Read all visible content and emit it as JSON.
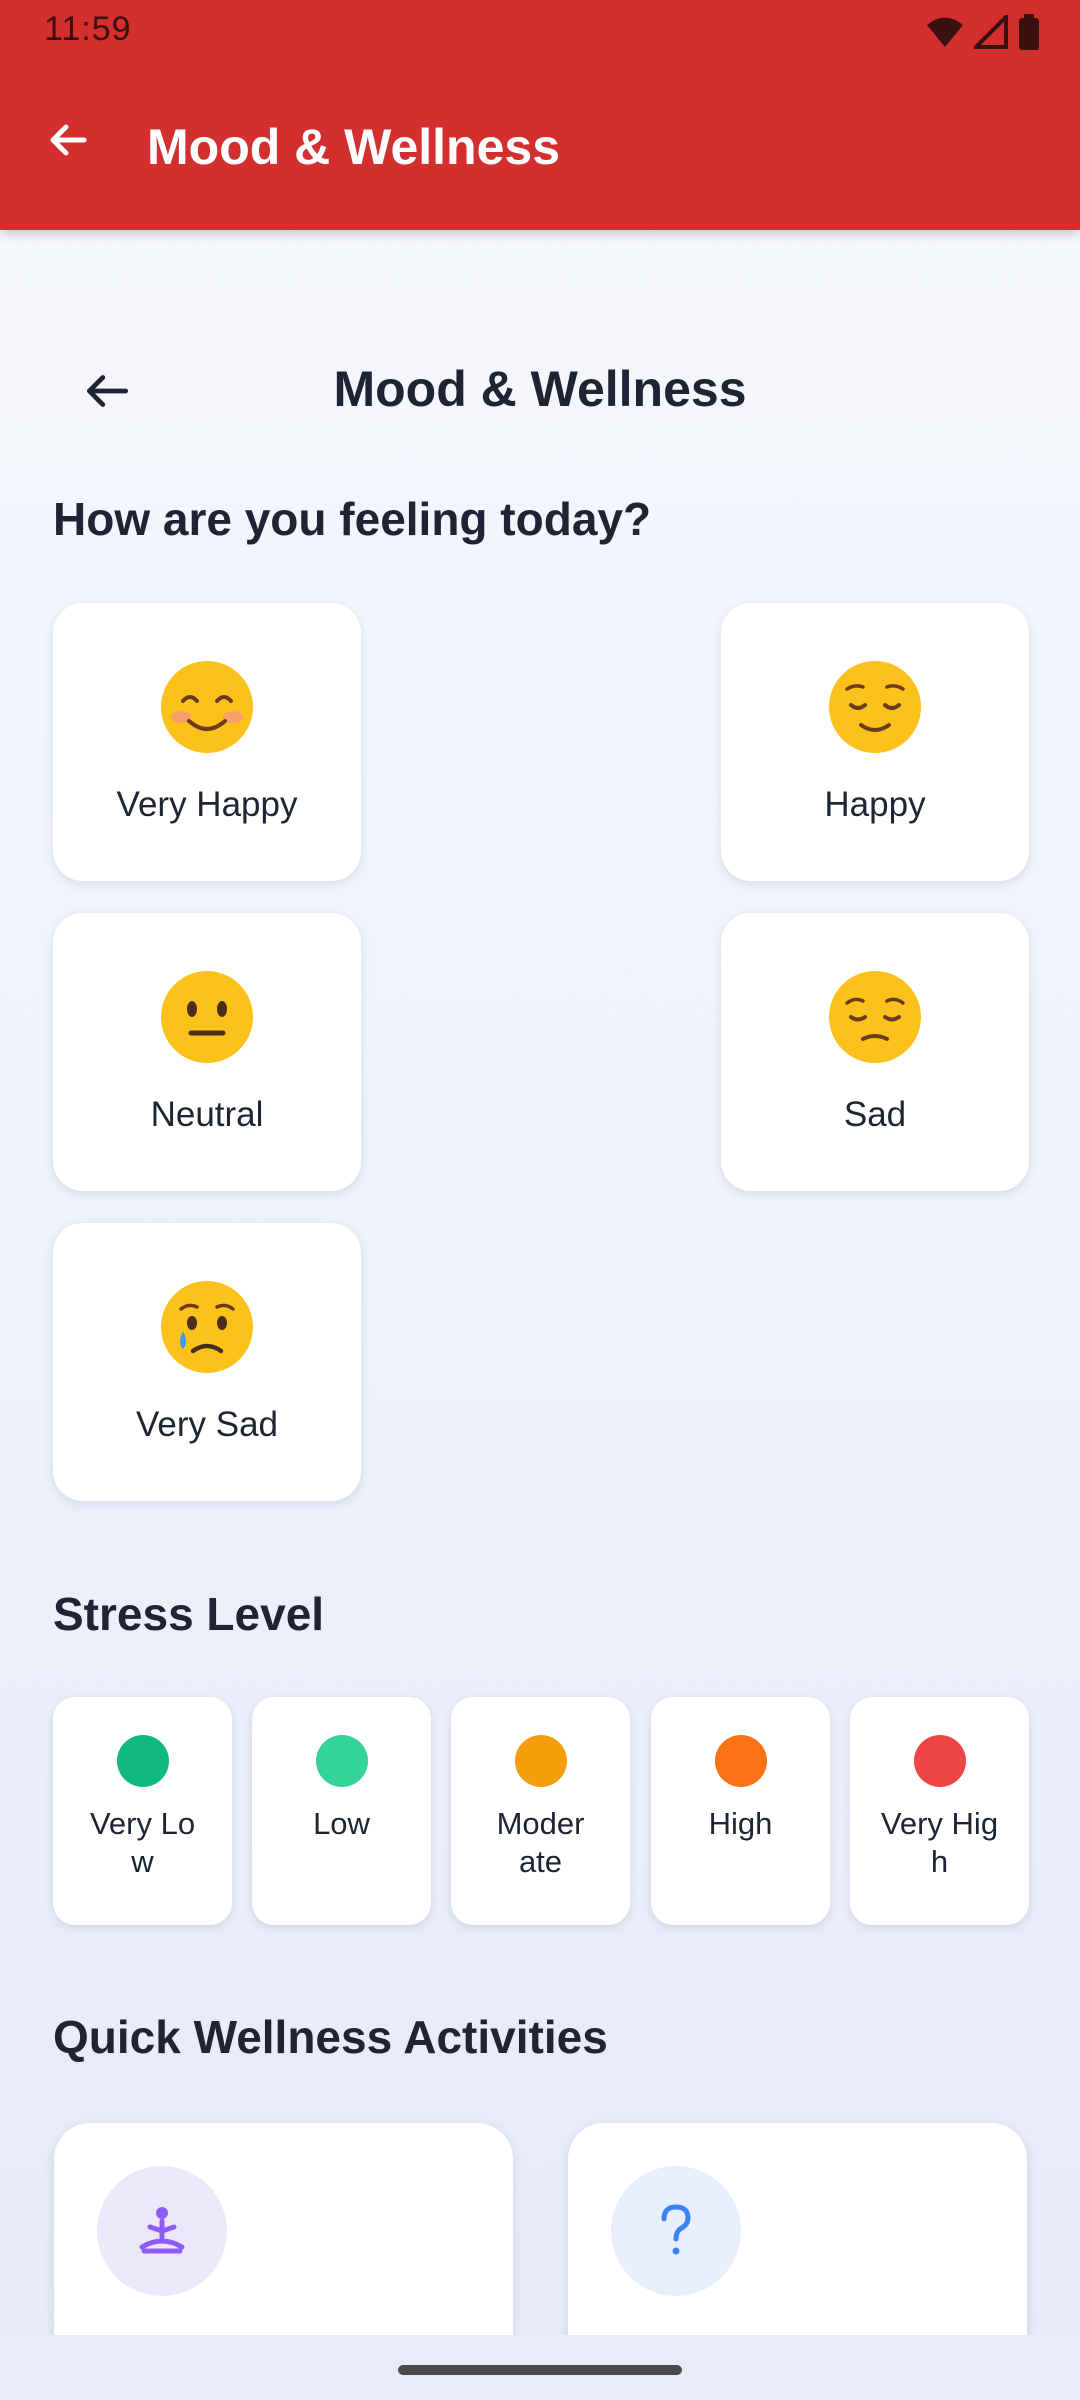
{
  "status_bar": {
    "time": "11:59",
    "icons": [
      "wifi-icon",
      "signal-icon",
      "battery-icon"
    ]
  },
  "app_bar": {
    "title": "Mood & Wellness",
    "back_icon": "arrow-left-icon",
    "color": "#d32f2f"
  },
  "page": {
    "title": "Mood & Wellness",
    "back_icon": "arrow-left-icon"
  },
  "mood_section": {
    "heading": "How are you feeling today?",
    "moods": [
      {
        "label": "Very Happy",
        "emoji": "smiling-face-with-smiling-eyes"
      },
      {
        "label": "Happy",
        "emoji": "relieved-face"
      },
      {
        "label": "Neutral",
        "emoji": "neutral-face"
      },
      {
        "label": "Sad",
        "emoji": "pensive-face"
      },
      {
        "label": "Very Sad",
        "emoji": "crying-face"
      }
    ]
  },
  "stress_section": {
    "heading": "Stress Level",
    "levels": [
      {
        "label": "Very Low",
        "color": "#10b981"
      },
      {
        "label": "Low",
        "color": "#34d399"
      },
      {
        "label": "Moderate",
        "color": "#f59e0b"
      },
      {
        "label": "High",
        "color": "#f97316"
      },
      {
        "label": "Very High",
        "color": "#ef4444"
      }
    ]
  },
  "activities_section": {
    "heading": "Quick Wellness Activities",
    "activities": [
      {
        "icon": "meditation-icon",
        "icon_color": "#8b5cf6",
        "bg_color": "#ede7fb"
      },
      {
        "icon": "question-mark-icon",
        "icon_color": "#3b82f6",
        "bg_color": "#e7effc"
      }
    ]
  }
}
